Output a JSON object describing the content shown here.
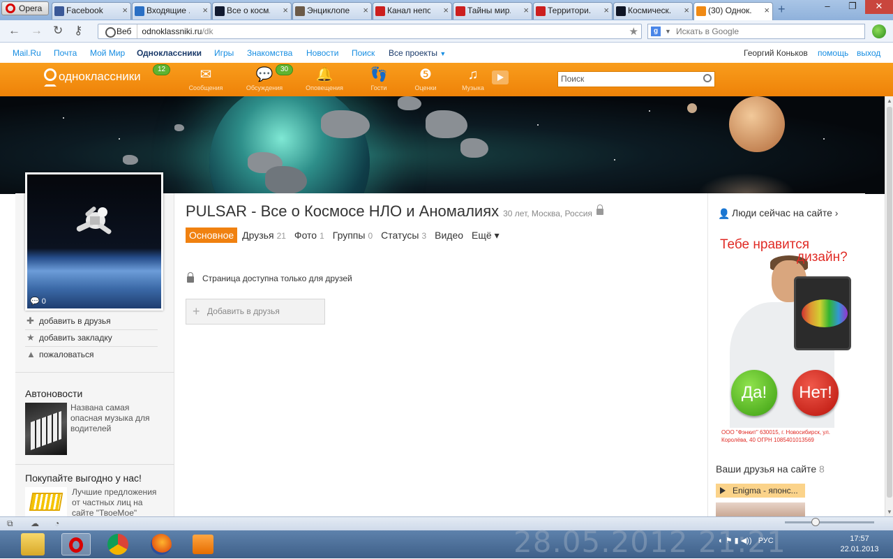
{
  "browser": {
    "menu_label": "Opera",
    "tabs": [
      {
        "title": "Facebook",
        "favicon_color": "#3b5998"
      },
      {
        "title": "Входящие ...",
        "favicon_color": "#2a6fc4"
      },
      {
        "title": "Все о косм...",
        "favicon_color": "#111a30"
      },
      {
        "title": "Энциклопе...",
        "favicon_color": "#6b5a48"
      },
      {
        "title": "Канал непо...",
        "favicon_color": "#cc1f1f"
      },
      {
        "title": "Тайны мир...",
        "favicon_color": "#cc1f1f"
      },
      {
        "title": "Территори...",
        "favicon_color": "#cc1f1f"
      },
      {
        "title": "Космическ...",
        "favicon_color": "#0f1525"
      },
      {
        "title": "(30) Однок...",
        "favicon_color": "#f08a14"
      }
    ],
    "new_tab_label": "+",
    "address": {
      "badge": "Веб",
      "host": "odnoklassniki.ru",
      "path": "/dk"
    },
    "search_placeholder": "Искать в Google",
    "window_buttons": [
      "–",
      "❐",
      "✕"
    ]
  },
  "mailru_bar": {
    "links": [
      "Mail.Ru",
      "Почта",
      "Мой Мир",
      "Одноклассники",
      "Игры",
      "Знакомства",
      "Новости",
      "Поиск",
      "Все проекты"
    ],
    "user_name": "Георгий Коньков",
    "help": "помощь",
    "logout": "выход"
  },
  "ok_header": {
    "logo_text": "одноклассники",
    "logo_badge": "12",
    "nav": [
      {
        "label": "Сообщения",
        "icon": "envelope-icon",
        "glyph": "✉",
        "badge": ""
      },
      {
        "label": "Обсуждения",
        "icon": "discussions-icon",
        "glyph": "💬",
        "badge": "30"
      },
      {
        "label": "Оповещения",
        "icon": "bell-icon",
        "glyph": "🔔",
        "badge": ""
      },
      {
        "label": "Гости",
        "icon": "footprints-icon",
        "glyph": "👣",
        "badge": ""
      },
      {
        "label": "Оценки",
        "icon": "rating-icon",
        "glyph": "❺",
        "badge": ""
      },
      {
        "label": "Музыка",
        "icon": "music-icon",
        "glyph": "♫",
        "badge": ""
      }
    ],
    "search_placeholder": "Поиск"
  },
  "profile": {
    "title": "PULSAR - Все о Космосе НЛО и Аномалиях",
    "meta": "30 лет, Москва, Россия",
    "photo_comments": "0",
    "tabs": [
      {
        "label": "Основное",
        "count": ""
      },
      {
        "label": "Друзья",
        "count": "21"
      },
      {
        "label": "Фото",
        "count": "1"
      },
      {
        "label": "Группы",
        "count": "0"
      },
      {
        "label": "Статусы",
        "count": "3"
      },
      {
        "label": "Видео",
        "count": ""
      },
      {
        "label": "Ещё ▾",
        "count": ""
      }
    ],
    "private_notice": "Страница доступна только для друзей",
    "add_friend_button": "Добавить в друзья"
  },
  "left_actions": [
    {
      "label": "добавить в друзья",
      "icon": "plus-icon",
      "glyph": "✚"
    },
    {
      "label": "добавить закладку",
      "icon": "star-icon",
      "glyph": "★"
    },
    {
      "label": "пожаловаться",
      "icon": "warning-icon",
      "glyph": "▲"
    }
  ],
  "autonews": {
    "title": "Автоновости",
    "headline": "Названа самая опасная музыка для водителей"
  },
  "shopping": {
    "title": "Покупайте выгодно у нас!",
    "text": "Лучшие предложения от частных лиц на сайте \"ТвоеМое\""
  },
  "right": {
    "people_online": "Люди сейчас на сайте ›",
    "ad": {
      "headline_1": "Тебе нравится",
      "headline_2": "дизайн?",
      "yes": "Да!",
      "no": "Нет!",
      "legal": "ООО \"Фэнкит\" 630015, г. Новосибирск, ул. Королёва, 40 ОГРН 1085401013569"
    },
    "friends_online_label": "Ваши друзья на сайте",
    "friends_online_count": "8",
    "friend_music": "Enigma - японс..."
  },
  "taskbar": {
    "watermark": "28.05.2012 21:21",
    "lang": "РУС",
    "time": "17:57",
    "date": "22.01.2013"
  }
}
